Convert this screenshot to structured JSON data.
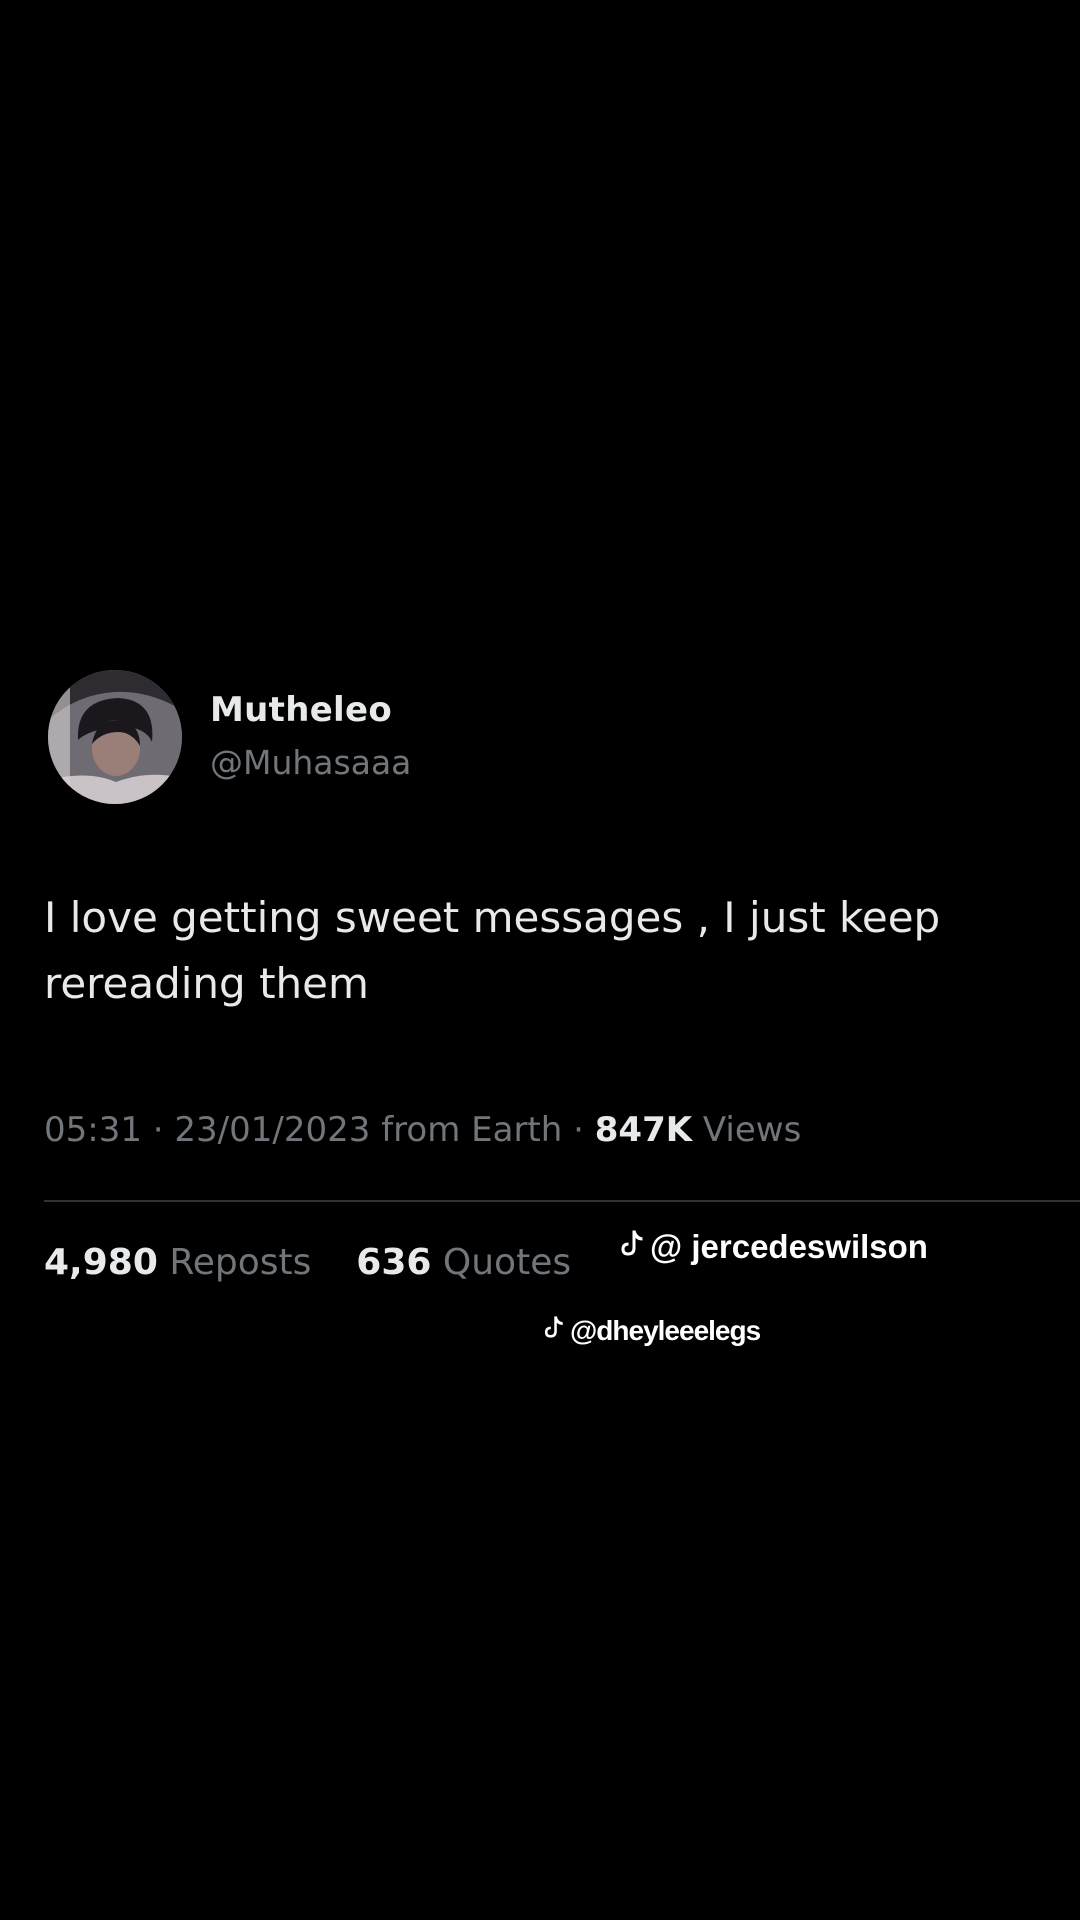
{
  "tweet": {
    "display_name": "Mutheleo",
    "handle": "@Muhasaaa",
    "text": "I love getting sweet messages , I just keep rereading them",
    "time": "05:31",
    "date": "23/01/2023",
    "source": "from Earth",
    "views_count": "847K",
    "views_label": "Views",
    "reposts_count": "4,980",
    "reposts_label": "Reposts",
    "quotes_count": "636",
    "quotes_label": "Quotes",
    "avatar_icon": "profile-photo"
  },
  "watermarks": {
    "primary": "@ jercedeswilson",
    "secondary": "@dheyleeelegs",
    "icon": "tiktok-icon"
  },
  "colors": {
    "background": "#000000",
    "primary_text": "#e7e9ea",
    "secondary_text": "#71767b",
    "divider": "#2f3336"
  }
}
